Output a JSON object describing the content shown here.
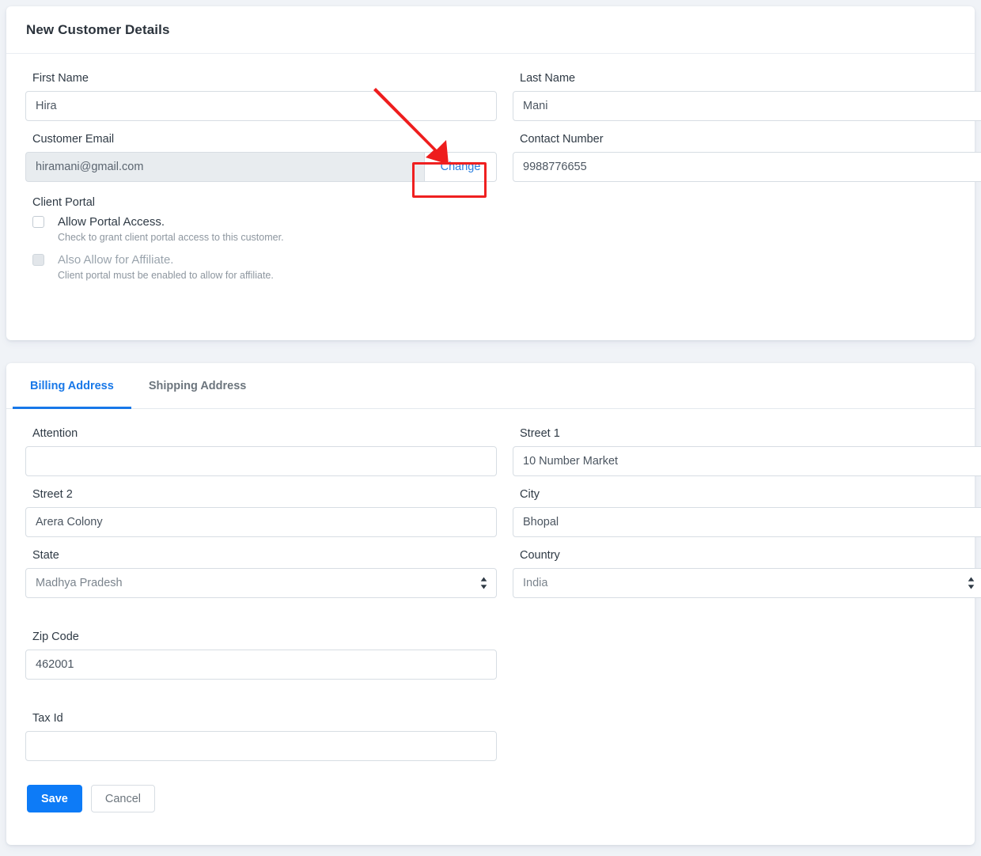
{
  "customer_card": {
    "title": "New Customer Details",
    "fields": {
      "first_name": {
        "label": "First Name",
        "value": "Hira"
      },
      "last_name": {
        "label": "Last Name",
        "value": "Mani"
      },
      "customer_email": {
        "label": "Customer Email",
        "value": "hiramani@gmail.com",
        "change_label": "Change"
      },
      "contact_number": {
        "label": "Contact Number",
        "value": "9988776655"
      }
    },
    "client_portal": {
      "title": "Client Portal",
      "allow_portal": {
        "label": "Allow Portal Access.",
        "help": "Check to grant client portal access to this customer.",
        "checked": false
      },
      "allow_affiliate": {
        "label": "Also Allow for Affiliate.",
        "help": "Client portal must be enabled to allow for affiliate.",
        "checked": false,
        "disabled": true
      }
    }
  },
  "address_card": {
    "tabs": [
      {
        "label": "Billing Address",
        "active": true
      },
      {
        "label": "Shipping Address",
        "active": false
      }
    ],
    "fields": {
      "attention": {
        "label": "Attention",
        "value": ""
      },
      "street1": {
        "label": "Street 1",
        "value": "10 Number Market"
      },
      "street2": {
        "label": "Street 2",
        "value": "Arera Colony"
      },
      "city": {
        "label": "City",
        "value": "Bhopal"
      },
      "state": {
        "label": "State",
        "value": "Madhya Pradesh"
      },
      "country": {
        "label": "Country",
        "value": "India"
      },
      "zip_code": {
        "label": "Zip Code",
        "value": "462001"
      },
      "tax_id": {
        "label": "Tax Id",
        "value": ""
      }
    },
    "buttons": {
      "save": "Save",
      "cancel": "Cancel"
    }
  },
  "annotation": {
    "highlight_target": "Change",
    "color": "#ef2020"
  },
  "colors": {
    "accent": "#1878e8",
    "primary_button": "#0d7bf7",
    "link": "#2a7fe0",
    "muted_text": "#6c757d",
    "page_background": "#f0f3f7",
    "card_background": "#ffffff",
    "disabled_input": "#e8ecef",
    "annotation_red": "#ef2020"
  }
}
